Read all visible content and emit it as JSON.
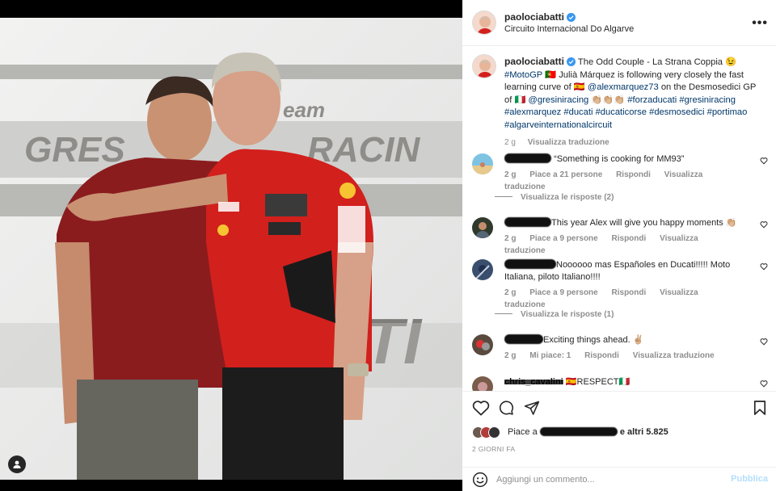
{
  "post": {
    "username": "paolociabatti",
    "location": "Circuito Internacional Do Algarve",
    "caption": {
      "title": "The Odd Couple - La Strana Coppia 😉",
      "line1_tag": "#MotoGP",
      "line1_rest": "🇵🇹 Julià Márquez is following very closely the fast",
      "line2_a": "learning curve of 🇪🇸",
      "line2_mention": "@alexmarquez73",
      "line2_b": "on the Desmosedici GP",
      "line3_a": "of 🇮🇹",
      "line3_tags": "@gresiniracing 👏🏼👏🏼👏🏼 #forzaducati #gresiniracing",
      "line4_tags": "#alexmarquez #ducati #ducaticorse #desmosedici #portimao",
      "line5_tags": "#algarveinternationalcircuit"
    },
    "caption_time": "2 g",
    "caption_translate": "Visualizza traduzione"
  },
  "comments": [
    {
      "text": "“Something is cooking for MM93”",
      "time": "2 g",
      "likes": "Piace a 21 persone",
      "reply": "Rispondi",
      "translate": "Visualizza traduzione",
      "replies": "Visualizza le risposte (2)"
    },
    {
      "text": "This year Alex will give you happy moments 👏🏼",
      "time": "2 g",
      "likes": "Piace a 9 persone",
      "reply": "Rispondi",
      "translate": "Visualizza traduzione"
    },
    {
      "text_a": "Noooooo mas Españoles en Ducati!!!!! Moto",
      "text_b": "Italiana, piloto Italiano!!!!",
      "time": "2 g",
      "likes": "Piace a 9 persone",
      "reply": "Rispondi",
      "translate": "Visualizza traduzione",
      "replies": "Visualizza le risposte (1)"
    },
    {
      "text": "Exciting things ahead. ✌🏼",
      "time": "2 g",
      "likes": "Mi piace: 1",
      "reply": "Rispondi",
      "translate": "Visualizza traduzione"
    },
    {
      "username": "chris_cavalini",
      "text": "🇪🇸RESPECT🇮🇹"
    }
  ],
  "likes_summary": {
    "prefix": "Piace a",
    "suffix": "e altri 5.825"
  },
  "date": "2 GIORNI FA",
  "compose": {
    "placeholder": "Aggiungi un commento...",
    "publish": "Pubblica"
  },
  "colors": {
    "link": "#00376b",
    "verified": "#3897f0",
    "publish_disabled": "#b2dffc",
    "photo_background": "#e9eaea",
    "shirt_left": "#8a1c1e",
    "shirt_right": "#d2201d"
  },
  "icons": [
    "verified-icon",
    "more-icon",
    "heart-icon",
    "comment-icon",
    "share-icon",
    "bookmark-icon",
    "emoji-icon",
    "user-tag-icon"
  ]
}
